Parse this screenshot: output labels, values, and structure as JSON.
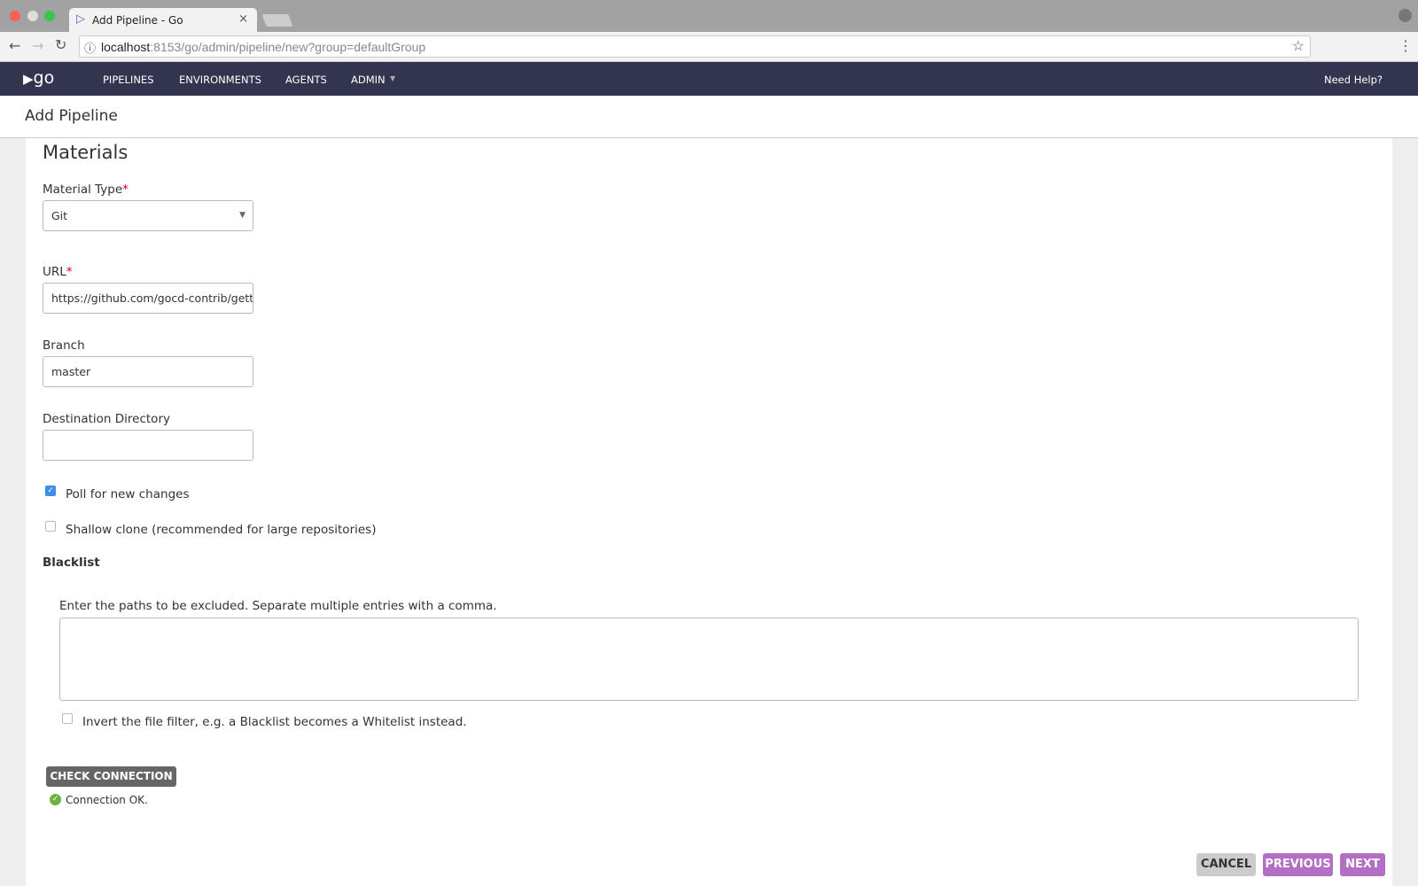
{
  "browser": {
    "tab_title": "Add Pipeline - Go",
    "tab_close": "×",
    "url_host": "localhost",
    "url_rest": ":8153/go/admin/pipeline/new?group=defaultGroup"
  },
  "nav": {
    "logo": "go",
    "items": [
      "PIPELINES",
      "ENVIRONMENTS",
      "AGENTS",
      "ADMIN"
    ],
    "help": "Need Help?"
  },
  "page_title": "Add Pipeline",
  "form": {
    "section": "Materials",
    "material_type": {
      "label": "Material Type",
      "required": "*",
      "value": "Git"
    },
    "url": {
      "label": "URL",
      "required": "*",
      "value": "https://github.com/gocd-contrib/getting-started-repo"
    },
    "branch": {
      "label": "Branch",
      "value": "master"
    },
    "destination": {
      "label": "Destination Directory",
      "value": ""
    },
    "poll": {
      "label": "Poll for new changes",
      "checked": true
    },
    "shallow": {
      "label": "Shallow clone (recommended for large repositories)",
      "checked": false
    },
    "blacklist": {
      "heading": "Blacklist",
      "help": "Enter the paths to be excluded. Separate multiple entries with a comma.",
      "value": "",
      "invert_label": "Invert the file filter, e.g. a Blacklist becomes a Whitelist instead.",
      "invert_checked": false
    },
    "check_connection": "CHECK CONNECTION",
    "connection_status": "Connection OK."
  },
  "actions": {
    "cancel": "CANCEL",
    "previous": "PREVIOUS",
    "next": "NEXT"
  },
  "colors": {
    "nav_bg": "#333550",
    "accent": "#b36fc4",
    "ok": "#6cb33e"
  }
}
